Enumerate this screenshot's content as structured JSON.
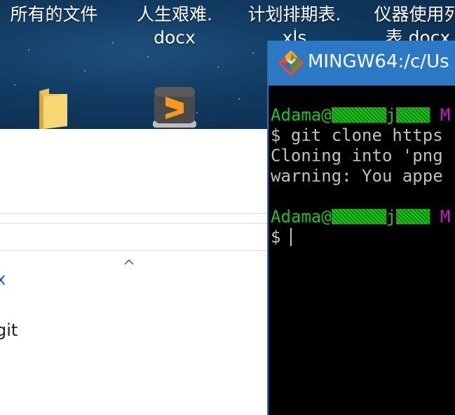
{
  "desktop": {
    "icons": [
      {
        "label": "所有的文件"
      },
      {
        "label": "人生艰难.\ndocx"
      },
      {
        "label": "计划排期表.\nxls"
      },
      {
        "label": "仪器使用列\n表.docx"
      }
    ]
  },
  "explorer": {
    "item_a": "x",
    "item_b": "git"
  },
  "terminal": {
    "title": "MINGW64:/c/Us",
    "prompt_user_prefix": "Adama@",
    "prompt_user_mid": "j",
    "prompt_path_start": "M",
    "cmd_line": "$ git clone https",
    "out_line1": "Cloning into 'png",
    "out_line2": "warning: You appe",
    "prompt_symbol": "$"
  },
  "colors": {
    "titlebar": "#2b78c4",
    "prompt_green": "#18c418",
    "prompt_magenta": "#c818c8",
    "terminal_bg": "#000000"
  }
}
